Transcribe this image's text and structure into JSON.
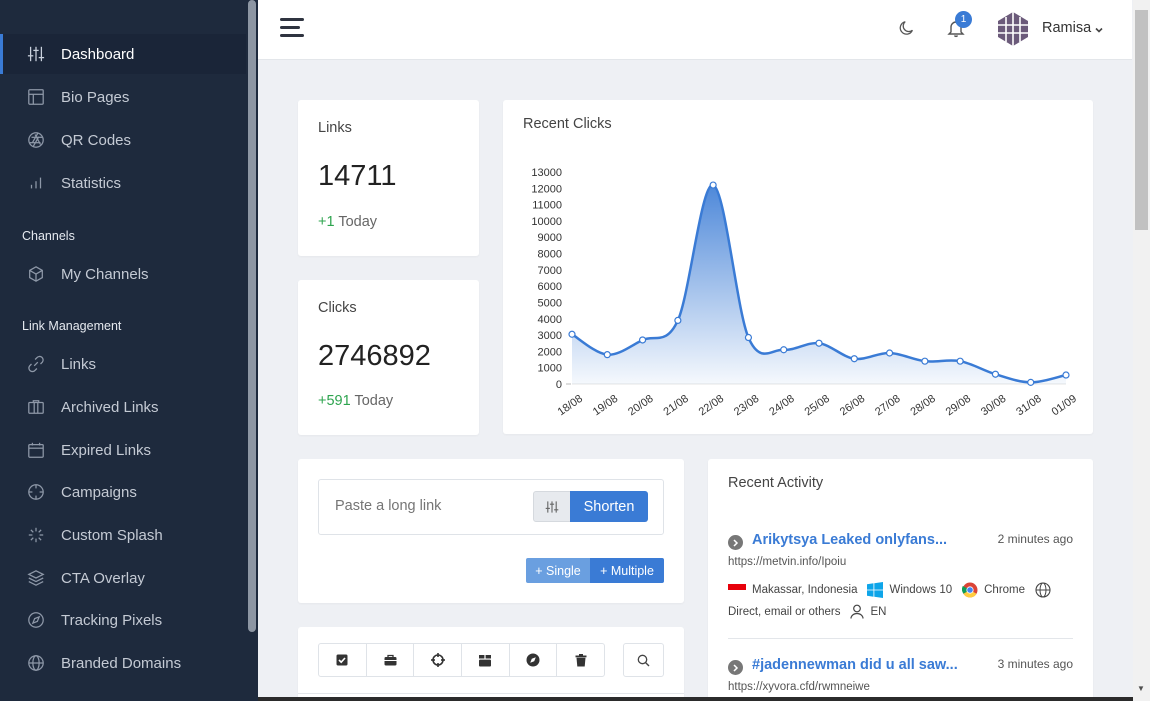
{
  "sidebar": {
    "items": [
      {
        "label": "Dashboard",
        "icon": "sliders-icon"
      },
      {
        "label": "Bio Pages",
        "icon": "layout-icon"
      },
      {
        "label": "QR Codes",
        "icon": "aperture-icon"
      },
      {
        "label": "Statistics",
        "icon": "bar-chart-icon"
      },
      {
        "label": "My Channels",
        "icon": "box-icon"
      },
      {
        "label": "Links",
        "icon": "link-icon"
      },
      {
        "label": "Archived Links",
        "icon": "archive-icon"
      },
      {
        "label": "Expired Links",
        "icon": "calendar-icon"
      },
      {
        "label": "Campaigns",
        "icon": "target-icon"
      },
      {
        "label": "Custom Splash",
        "icon": "loader-icon"
      },
      {
        "label": "CTA Overlay",
        "icon": "layers-icon"
      },
      {
        "label": "Tracking Pixels",
        "icon": "compass-icon"
      },
      {
        "label": "Branded Domains",
        "icon": "globe-icon"
      }
    ],
    "headings": {
      "channels": "Channels",
      "link_management": "Link Management"
    }
  },
  "topbar": {
    "notification_count": "1",
    "username": "Ramisa"
  },
  "stats": {
    "links": {
      "label": "Links",
      "value": "14711",
      "delta": "+1",
      "delta_suffix": "Today"
    },
    "clicks": {
      "label": "Clicks",
      "value": "2746892",
      "delta": "+591",
      "delta_suffix": "Today"
    }
  },
  "chart_data": {
    "type": "area",
    "title": "Recent Clicks",
    "x": [
      "18/08",
      "19/08",
      "20/08",
      "21/08",
      "22/08",
      "23/08",
      "24/08",
      "25/08",
      "26/08",
      "27/08",
      "28/08",
      "29/08",
      "30/08",
      "31/08",
      "01/09"
    ],
    "values": [
      3050,
      1800,
      2700,
      3900,
      12200,
      2850,
      2100,
      2500,
      1550,
      1900,
      1400,
      1400,
      600,
      100,
      550
    ],
    "yticks": [
      0,
      1000,
      2000,
      3000,
      4000,
      5000,
      6000,
      7000,
      8000,
      9000,
      10000,
      11000,
      12000,
      13000
    ],
    "ylim": [
      0,
      13000
    ],
    "color": "#3a7bd5"
  },
  "shorten": {
    "placeholder": "Paste a long link",
    "button": "Shorten",
    "single": "+ Single",
    "multiple": "+ Multiple"
  },
  "activity": {
    "title": "Recent Activity",
    "items": [
      {
        "title": "Arikytsya Leaked onlyfans...",
        "time": "2 minutes ago",
        "url": "https://metvin.info/Ipoiu",
        "location": "Makassar, Indonesia",
        "os": "Windows 10",
        "browser": "Chrome",
        "referrer": "Direct, email or others",
        "language": "EN"
      },
      {
        "title": "#jadennewman did u all saw...",
        "time": "3 minutes ago",
        "url": "https://xyvora.cfd/rwmneiwe"
      }
    ]
  }
}
